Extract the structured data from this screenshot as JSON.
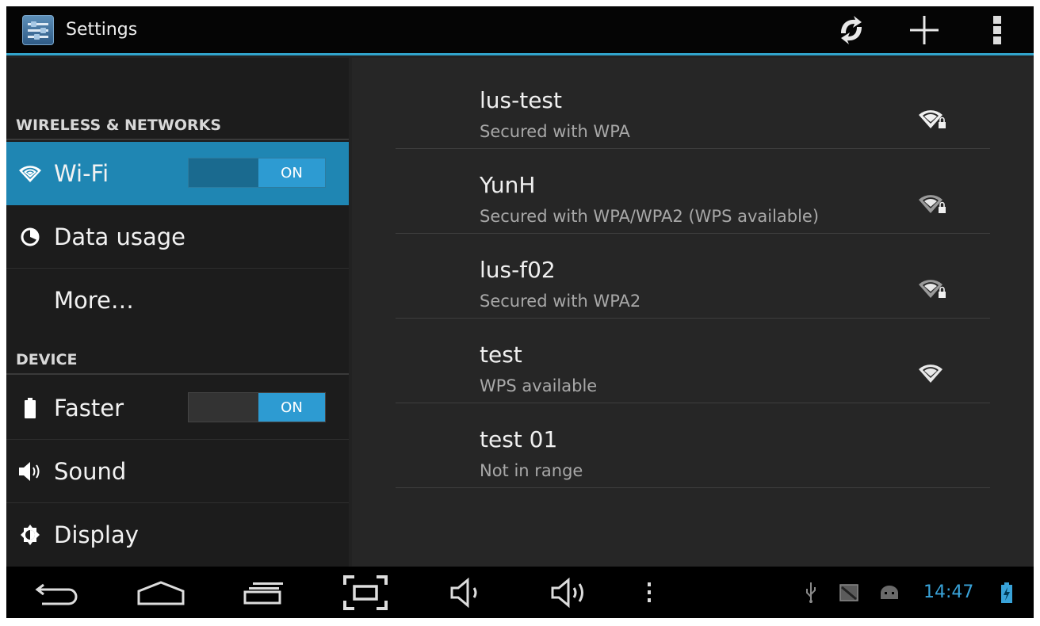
{
  "actionbar": {
    "title": "Settings",
    "app_icon": "settings-sliders-icon",
    "actions": [
      "wps-icon",
      "add-network-icon",
      "overflow-menu-icon"
    ]
  },
  "sidebar": {
    "headers": [
      "WIRELESS & NETWORKS",
      "DEVICE"
    ],
    "items": [
      {
        "label": "Wi-Fi",
        "icon": "wifi-icon",
        "toggle": "ON",
        "selected": true
      },
      {
        "label": "Data usage",
        "icon": "data-usage-icon"
      },
      {
        "label": "More…",
        "icon": ""
      },
      {
        "label": "Faster",
        "icon": "battery-icon",
        "toggle": "ON"
      },
      {
        "label": "Sound",
        "icon": "speaker-icon"
      },
      {
        "label": "Display",
        "icon": "brightness-icon"
      }
    ]
  },
  "networks": [
    {
      "ssid": "lus-test",
      "status": "Secured with WPA",
      "signal": "wifi-locked-icon"
    },
    {
      "ssid": "YunH",
      "status": "Secured with WPA/WPA2 (WPS available)",
      "signal": "wifi-locked-icon"
    },
    {
      "ssid": "lus-f02",
      "status": "Secured with WPA2",
      "signal": "wifi-locked-icon"
    },
    {
      "ssid": "test",
      "status": "WPS available",
      "signal": "wifi-icon"
    },
    {
      "ssid": "test 01",
      "status": "Not in range",
      "signal": ""
    }
  ],
  "navbar": {
    "buttons": [
      "back-icon",
      "home-icon",
      "recent-apps-icon",
      "screenshot-icon",
      "volume-down-icon",
      "volume-up-icon",
      "menu-dots-icon"
    ],
    "status_icons": [
      "usb-icon",
      "image-notification-icon",
      "android-debug-icon",
      "battery-charging-icon"
    ],
    "clock": "14:47"
  },
  "colors": {
    "accent": "#31a4cc",
    "selected_item": "#1f86b3",
    "toggle_on": "#2d9bd2",
    "clock": "#39a3d9"
  }
}
